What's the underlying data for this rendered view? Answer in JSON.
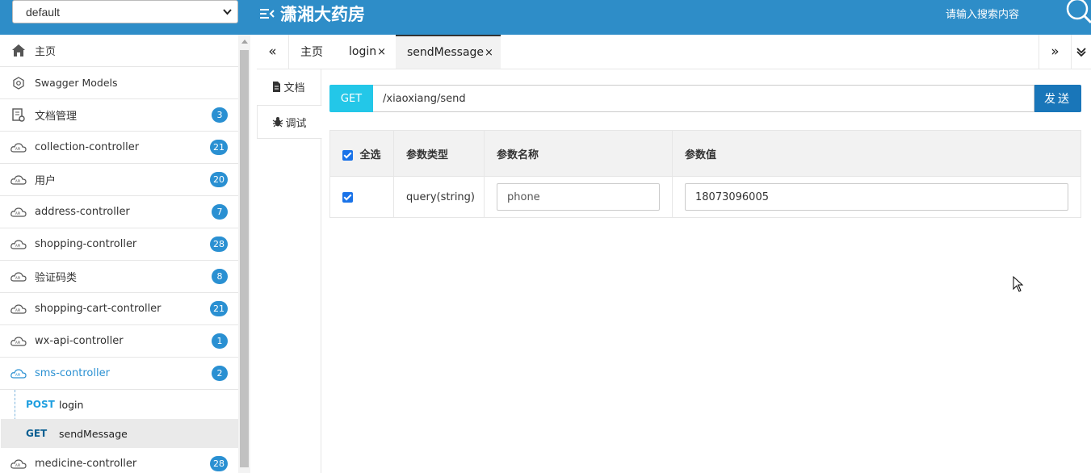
{
  "header": {
    "group_select": "default",
    "brand_title": "潇湘大药房",
    "search_placeholder": "请输入搜索内容",
    "colors": {
      "header_bg": "#2e8dc8",
      "badge_bg": "#2a90d2"
    }
  },
  "sidebar": {
    "items": [
      {
        "label": "主页",
        "icon": "home-icon"
      },
      {
        "label": "Swagger Models",
        "icon": "models-icon"
      },
      {
        "label": "文档管理",
        "icon": "doc-manage-icon",
        "count": "3"
      },
      {
        "label": "collection-controller",
        "icon": "api-cloud-icon",
        "count": "21"
      },
      {
        "label": "用户",
        "icon": "api-cloud-icon",
        "count": "20"
      },
      {
        "label": "address-controller",
        "icon": "api-cloud-icon",
        "count": "7"
      },
      {
        "label": "shopping-controller",
        "icon": "api-cloud-icon",
        "count": "28"
      },
      {
        "label": "验证码类",
        "icon": "api-cloud-icon",
        "count": "8"
      },
      {
        "label": "shopping-cart-controller",
        "icon": "api-cloud-icon",
        "count": "21"
      },
      {
        "label": "wx-api-controller",
        "icon": "api-cloud-icon",
        "count": "1"
      },
      {
        "label": "sms-controller",
        "icon": "api-cloud-icon",
        "count": "2"
      }
    ],
    "sub_items": [
      {
        "method": "POST",
        "label": "login"
      },
      {
        "method": "GET",
        "label": "sendMessage"
      }
    ],
    "cut_item": {
      "label": "medicine-controller",
      "count": "28"
    }
  },
  "tabs": {
    "items": [
      {
        "label": "主页"
      },
      {
        "label": "login",
        "close": "×"
      },
      {
        "label": "sendMessage",
        "close": "×"
      }
    ]
  },
  "subtabs": {
    "doc": "文档",
    "debug": "调试"
  },
  "request": {
    "method": "GET",
    "url": "/xiaoxiang/send",
    "send_label": "发送"
  },
  "params_table": {
    "headers": {
      "select_all": "全选",
      "type": "参数类型",
      "name": "参数名称",
      "value": "参数值"
    },
    "rows": [
      {
        "type": "query(string)",
        "name": "phone",
        "value": "18073096005"
      }
    ]
  }
}
